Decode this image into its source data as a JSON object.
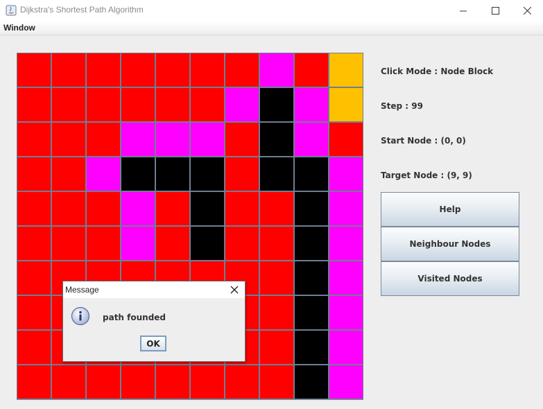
{
  "window": {
    "title": "Dijkstra's Shortest Path Algorithm",
    "menu": [
      "Window"
    ]
  },
  "colors": {
    "R": "#ff0000",
    "M": "#ff00ff",
    "K": "#000000",
    "Y": "#ffc000"
  },
  "grid": {
    "rows": 10,
    "cols": 10,
    "cells": [
      [
        "R",
        "R",
        "R",
        "R",
        "R",
        "R",
        "R",
        "M",
        "R",
        "Y"
      ],
      [
        "R",
        "R",
        "R",
        "R",
        "R",
        "R",
        "M",
        "K",
        "M",
        "Y"
      ],
      [
        "R",
        "R",
        "R",
        "M",
        "M",
        "M",
        "R",
        "K",
        "M",
        "R"
      ],
      [
        "R",
        "R",
        "M",
        "K",
        "K",
        "K",
        "R",
        "K",
        "K",
        "M"
      ],
      [
        "R",
        "R",
        "R",
        "M",
        "R",
        "K",
        "R",
        "R",
        "K",
        "M"
      ],
      [
        "R",
        "R",
        "R",
        "M",
        "R",
        "K",
        "R",
        "R",
        "K",
        "M"
      ],
      [
        "R",
        "R",
        "R",
        "R",
        "R",
        "R",
        "R",
        "R",
        "K",
        "M"
      ],
      [
        "R",
        "R",
        "R",
        "R",
        "R",
        "R",
        "R",
        "R",
        "K",
        "M"
      ],
      [
        "R",
        "R",
        "R",
        "R",
        "R",
        "R",
        "R",
        "R",
        "K",
        "M"
      ],
      [
        "R",
        "R",
        "R",
        "R",
        "R",
        "R",
        "R",
        "R",
        "K",
        "M"
      ]
    ]
  },
  "panel": {
    "click_mode": "Click Mode : Node Block",
    "step": "Step : 99",
    "start_node": "Start Node : (0, 0)",
    "target_node": "Target Node : (9, 9)",
    "buttons": {
      "help": "Help",
      "neighbour": "Neighbour Nodes",
      "visited": "Visited Nodes"
    }
  },
  "dialog": {
    "title": "Message",
    "message": "path founded",
    "ok": "OK"
  }
}
